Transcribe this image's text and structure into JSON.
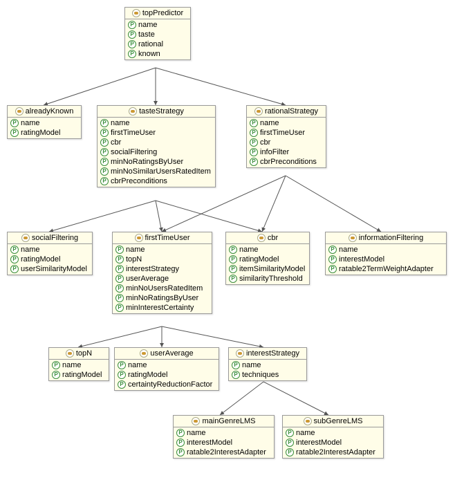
{
  "nodes": {
    "topPredictor": {
      "title": "topPredictor",
      "props": [
        "name",
        "taste",
        "rational",
        "known"
      ]
    },
    "alreadyKnown": {
      "title": "alreadyKnown",
      "props": [
        "name",
        "ratingModel"
      ]
    },
    "tasteStrategy": {
      "title": "tasteStrategy",
      "props": [
        "name",
        "firstTimeUser",
        "cbr",
        "socialFiltering",
        "minNoRatingsByUser",
        "minNoSimilarUsersRatedItem",
        "cbrPreconditions"
      ]
    },
    "rationalStrategy": {
      "title": "rationalStrategy",
      "props": [
        "name",
        "firstTimeUser",
        "cbr",
        "infoFilter",
        "cbrPreconditions"
      ]
    },
    "socialFiltering": {
      "title": "socialFiltering",
      "props": [
        "name",
        "ratingModel",
        "userSimilarityModel"
      ]
    },
    "firstTimeUser": {
      "title": "firstTimeUser",
      "props": [
        "name",
        "topN",
        "interestStrategy",
        "userAverage",
        "minNoUsersRatedItem",
        "minNoRatingsByUser",
        "minInterestCertainty"
      ]
    },
    "cbr": {
      "title": "cbr",
      "props": [
        "name",
        "ratingModel",
        "itemSimilarityModel",
        "similarityThreshold"
      ]
    },
    "informationFiltering": {
      "title": "informationFiltering",
      "props": [
        "name",
        "interestModel",
        "ratable2TermWeightAdapter"
      ]
    },
    "topN": {
      "title": "topN",
      "props": [
        "name",
        "ratingModel"
      ]
    },
    "userAverage": {
      "title": "userAverage",
      "props": [
        "name",
        "ratingModel",
        "certaintyReductionFactor"
      ]
    },
    "interestStrategy": {
      "title": "interestStrategy",
      "props": [
        "name",
        "techniques"
      ]
    },
    "mainGenreLMS": {
      "title": "mainGenreLMS",
      "props": [
        "name",
        "interestModel",
        "ratable2InterestAdapter"
      ]
    },
    "subGenreLMS": {
      "title": "subGenreLMS",
      "props": [
        "name",
        "interestModel",
        "ratable2InterestAdapter"
      ]
    }
  },
  "chart_data": {
    "type": "diagram",
    "description": "UML-style object/class diagram showing a predictor strategy hierarchy with connectors between nodes. Each node lists its title and property names.",
    "nodes": [
      {
        "id": "topPredictor",
        "title": "topPredictor",
        "props": [
          "name",
          "taste",
          "rational",
          "known"
        ]
      },
      {
        "id": "alreadyKnown",
        "title": "alreadyKnown",
        "props": [
          "name",
          "ratingModel"
        ]
      },
      {
        "id": "tasteStrategy",
        "title": "tasteStrategy",
        "props": [
          "name",
          "firstTimeUser",
          "cbr",
          "socialFiltering",
          "minNoRatingsByUser",
          "minNoSimilarUsersRatedItem",
          "cbrPreconditions"
        ]
      },
      {
        "id": "rationalStrategy",
        "title": "rationalStrategy",
        "props": [
          "name",
          "firstTimeUser",
          "cbr",
          "infoFilter",
          "cbrPreconditions"
        ]
      },
      {
        "id": "socialFiltering",
        "title": "socialFiltering",
        "props": [
          "name",
          "ratingModel",
          "userSimilarityModel"
        ]
      },
      {
        "id": "firstTimeUser",
        "title": "firstTimeUser",
        "props": [
          "name",
          "topN",
          "interestStrategy",
          "userAverage",
          "minNoUsersRatedItem",
          "minNoRatingsByUser",
          "minInterestCertainty"
        ]
      },
      {
        "id": "cbr",
        "title": "cbr",
        "props": [
          "name",
          "ratingModel",
          "itemSimilarityModel",
          "similarityThreshold"
        ]
      },
      {
        "id": "informationFiltering",
        "title": "informationFiltering",
        "props": [
          "name",
          "interestModel",
          "ratable2TermWeightAdapter"
        ]
      },
      {
        "id": "topN",
        "title": "topN",
        "props": [
          "name",
          "ratingModel"
        ]
      },
      {
        "id": "userAverage",
        "title": "userAverage",
        "props": [
          "name",
          "ratingModel",
          "certaintyReductionFactor"
        ]
      },
      {
        "id": "interestStrategy",
        "title": "interestStrategy",
        "props": [
          "name",
          "techniques"
        ]
      },
      {
        "id": "mainGenreLMS",
        "title": "mainGenreLMS",
        "props": [
          "name",
          "interestModel",
          "ratable2InterestAdapter"
        ]
      },
      {
        "id": "subGenreLMS",
        "title": "subGenreLMS",
        "props": [
          "name",
          "interestModel",
          "ratable2InterestAdapter"
        ]
      }
    ],
    "edges": [
      [
        "topPredictor",
        "alreadyKnown"
      ],
      [
        "topPredictor",
        "tasteStrategy"
      ],
      [
        "topPredictor",
        "rationalStrategy"
      ],
      [
        "tasteStrategy",
        "socialFiltering"
      ],
      [
        "tasteStrategy",
        "firstTimeUser"
      ],
      [
        "tasteStrategy",
        "cbr"
      ],
      [
        "rationalStrategy",
        "firstTimeUser"
      ],
      [
        "rationalStrategy",
        "cbr"
      ],
      [
        "rationalStrategy",
        "informationFiltering"
      ],
      [
        "firstTimeUser",
        "topN"
      ],
      [
        "firstTimeUser",
        "userAverage"
      ],
      [
        "firstTimeUser",
        "interestStrategy"
      ],
      [
        "interestStrategy",
        "mainGenreLMS"
      ],
      [
        "interestStrategy",
        "subGenreLMS"
      ]
    ]
  }
}
